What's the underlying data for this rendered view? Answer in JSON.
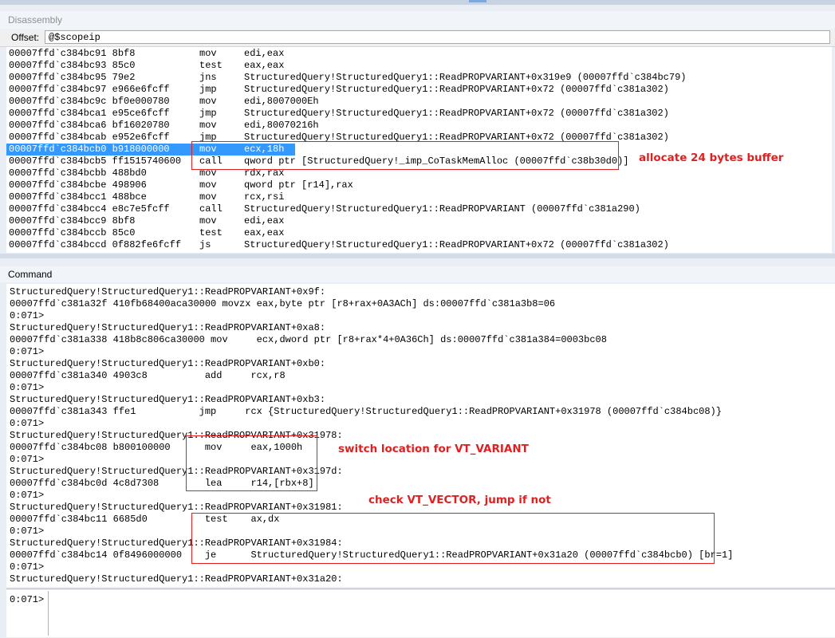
{
  "disassembly": {
    "title": "Disassembly",
    "offset_label": "Offset:",
    "offset_value": "@$scopeip",
    "rows": [
      {
        "addr": "00007ffd`c384bc91 8bf8",
        "op": "mov",
        "arg": "edi,eax"
      },
      {
        "addr": "00007ffd`c384bc93 85c0",
        "op": "test",
        "arg": "eax,eax"
      },
      {
        "addr": "00007ffd`c384bc95 79e2",
        "op": "jns",
        "arg": "StructuredQuery!StructuredQuery1::ReadPROPVARIANT+0x319e9 (00007ffd`c384bc79)"
      },
      {
        "addr": "00007ffd`c384bc97 e966e6fcff",
        "op": "jmp",
        "arg": "StructuredQuery!StructuredQuery1::ReadPROPVARIANT+0x72 (00007ffd`c381a302)"
      },
      {
        "addr": "00007ffd`c384bc9c bf0e000780",
        "op": "mov",
        "arg": "edi,8007000Eh"
      },
      {
        "addr": "00007ffd`c384bca1 e95ce6fcff",
        "op": "jmp",
        "arg": "StructuredQuery!StructuredQuery1::ReadPROPVARIANT+0x72 (00007ffd`c381a302)"
      },
      {
        "addr": "00007ffd`c384bca6 bf16020780",
        "op": "mov",
        "arg": "edi,80070216h"
      },
      {
        "addr": "00007ffd`c384bcab e952e6fcff",
        "op": "jmp",
        "arg": "StructuredQuery!StructuredQuery1::ReadPROPVARIANT+0x72 (00007ffd`c381a302)"
      },
      {
        "addr": "00007ffd`c384bcb0 b918000000",
        "op": "mov",
        "arg": "ecx,18h"
      },
      {
        "addr": "00007ffd`c384bcb5 ff1515740600",
        "op": "call",
        "arg": "qword ptr [StructuredQuery!_imp_CoTaskMemAlloc (00007ffd`c38b30d0)]"
      },
      {
        "addr": "00007ffd`c384bcbb 488bd0",
        "op": "mov",
        "arg": "rdx,rax"
      },
      {
        "addr": "00007ffd`c384bcbe 498906",
        "op": "mov",
        "arg": "qword ptr [r14],rax"
      },
      {
        "addr": "00007ffd`c384bcc1 488bce",
        "op": "mov",
        "arg": "rcx,rsi"
      },
      {
        "addr": "00007ffd`c384bcc4 e8c7e5fcff",
        "op": "call",
        "arg": "StructuredQuery!StructuredQuery1::ReadPROPVARIANT (00007ffd`c381a290)"
      },
      {
        "addr": "00007ffd`c384bcc9 8bf8",
        "op": "mov",
        "arg": "edi,eax"
      },
      {
        "addr": "00007ffd`c384bccb 85c0",
        "op": "test",
        "arg": "eax,eax"
      },
      {
        "addr": "00007ffd`c384bccd 0f882fe6fcff",
        "op": "js",
        "arg": "StructuredQuery!StructuredQuery1::ReadPROPVARIANT+0x72 (00007ffd`c381a302)"
      }
    ],
    "selected_row_index": 8
  },
  "command": {
    "title": "Command",
    "lines": [
      "StructuredQuery!StructuredQuery1::ReadPROPVARIANT+0x9f:",
      "00007ffd`c381a32f 410fb68400aca30000 movzx eax,byte ptr [r8+rax+0A3ACh] ds:00007ffd`c381a3b8=06",
      "0:071>",
      "StructuredQuery!StructuredQuery1::ReadPROPVARIANT+0xa8:",
      "00007ffd`c381a338 418b8c806ca30000 mov     ecx,dword ptr [r8+rax*4+0A36Ch] ds:00007ffd`c381a384=0003bc08",
      "0:071>",
      "StructuredQuery!StructuredQuery1::ReadPROPVARIANT+0xb0:",
      "00007ffd`c381a340 4903c8          add     rcx,r8",
      "0:071>",
      "StructuredQuery!StructuredQuery1::ReadPROPVARIANT+0xb3:",
      "00007ffd`c381a343 ffe1           jmp     rcx {StructuredQuery!StructuredQuery1::ReadPROPVARIANT+0x31978 (00007ffd`c384bc08)}",
      "0:071>",
      "StructuredQuery!StructuredQuery1::ReadPROPVARIANT+0x31978:",
      "00007ffd`c384bc08 b800100000      mov     eax,1000h",
      "0:071>",
      "StructuredQuery!StructuredQuery1::ReadPROPVARIANT+0x3197d:",
      "00007ffd`c384bc0d 4c8d7308        lea     r14,[rbx+8]",
      "0:071>",
      "StructuredQuery!StructuredQuery1::ReadPROPVARIANT+0x31981:",
      "00007ffd`c384bc11 6685d0          test    ax,dx",
      "0:071>",
      "StructuredQuery!StructuredQuery1::ReadPROPVARIANT+0x31984:",
      "00007ffd`c384bc14 0f8496000000    je      StructuredQuery!StructuredQuery1::ReadPROPVARIANT+0x31a20 (00007ffd`c384bcb0) [br=1]",
      "0:071>",
      "StructuredQuery!StructuredQuery1::ReadPROPVARIANT+0x31a20:"
    ],
    "prompt": "0:071>",
    "input_value": ""
  },
  "annotations": {
    "alloc_note": "allocate 24 bytes buffer",
    "switch_note": "switch location for VT_VARIANT",
    "vector_note": "check VT_VECTOR,  jump if not"
  },
  "colors": {
    "selection": "#3399ff",
    "annotation_red": "#e02020"
  }
}
